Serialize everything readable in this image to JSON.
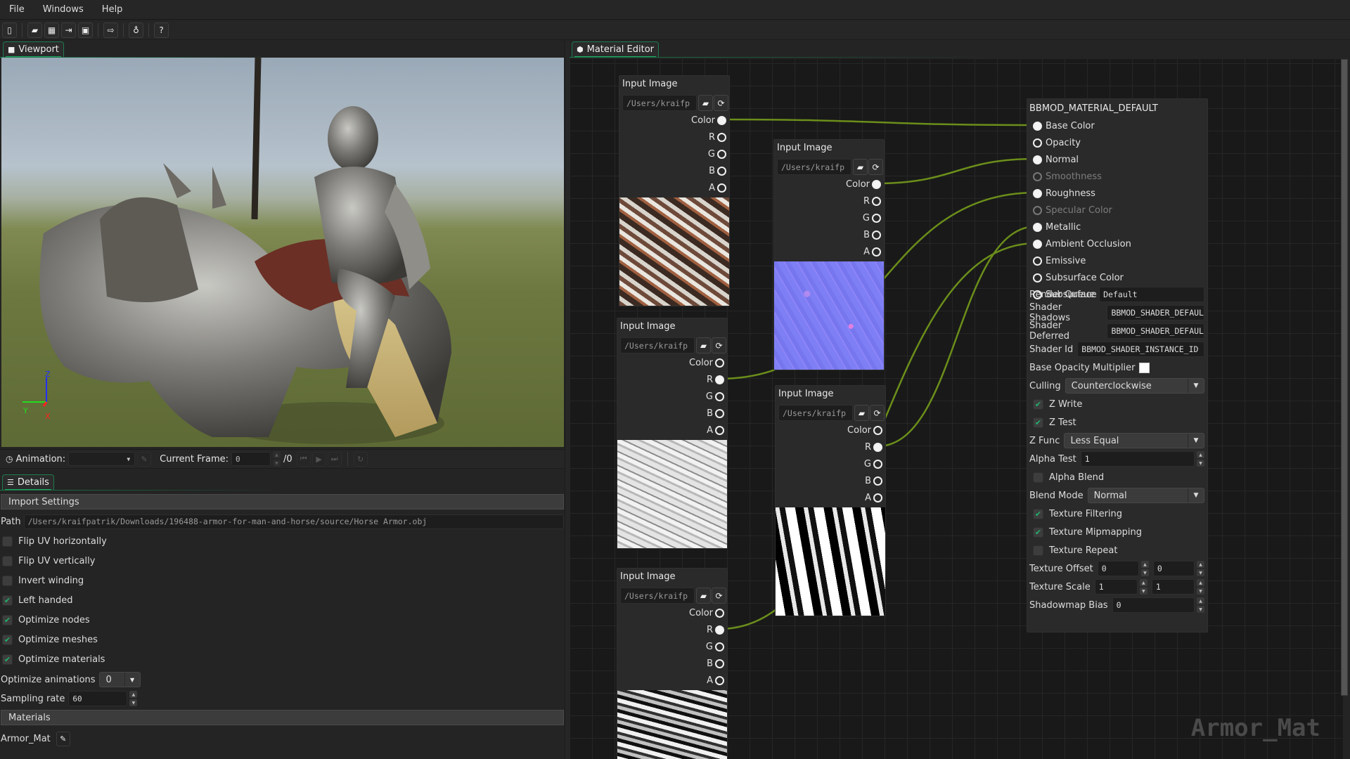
{
  "menu": {
    "items": [
      "File",
      "Windows",
      "Help"
    ]
  },
  "toolbar": {
    "buttons": [
      {
        "name": "new-file-icon",
        "glyph": "🗋"
      },
      {
        "name": "open-folder-icon",
        "glyph": "📂"
      },
      {
        "name": "film-icon",
        "glyph": "🎞"
      },
      {
        "name": "import-icon",
        "glyph": "⇥"
      },
      {
        "name": "image-icon",
        "glyph": "🖼"
      },
      {
        "name": "export-icon",
        "glyph": "⇨"
      },
      {
        "name": "lightbulb-icon",
        "glyph": "💡"
      },
      {
        "name": "help-icon",
        "glyph": "?"
      }
    ]
  },
  "viewport": {
    "tab_label": "Viewport",
    "gizmo": {
      "x_label": "X",
      "y_label": "Y",
      "z_label": "Z",
      "x_color": "#ff2020",
      "y_color": "#20dd20",
      "z_color": "#2030ff"
    }
  },
  "animation_bar": {
    "animation_label": "Animation:",
    "animation_value": "",
    "current_frame_label": "Current Frame:",
    "current_frame_value": "0",
    "frame_total": "/0"
  },
  "details": {
    "tab_label": "Details",
    "import_settings_header": "Import Settings",
    "path_label": "Path",
    "path_value": "/Users/kraifpatrik/Downloads/196488-armor-for-man-and-horse/source/Horse Armor.obj",
    "checkboxes": [
      {
        "label": "Flip UV horizontally",
        "checked": false
      },
      {
        "label": "Flip UV vertically",
        "checked": false
      },
      {
        "label": "Invert winding",
        "checked": false
      },
      {
        "label": "Left handed",
        "checked": true
      },
      {
        "label": "Optimize nodes",
        "checked": true
      },
      {
        "label": "Optimize meshes",
        "checked": true
      },
      {
        "label": "Optimize materials",
        "checked": true
      }
    ],
    "optimize_animations_label": "Optimize animations",
    "optimize_animations_value": "0",
    "sampling_rate_label": "Sampling rate",
    "sampling_rate_value": "60",
    "materials_header": "Materials",
    "material_name": "Armor_Mat"
  },
  "material_editor": {
    "tab_label": "Material Editor",
    "watermark": "Armor_Mat",
    "wire_color": "#6b8e1a",
    "input_nodes": [
      {
        "title": "Input Image",
        "path": "/Users/kraifp",
        "pins": [
          {
            "label": "Color",
            "connected": true
          },
          {
            "label": "R",
            "connected": false
          },
          {
            "label": "G",
            "connected": false
          },
          {
            "label": "B",
            "connected": false
          },
          {
            "label": "A",
            "connected": false
          }
        ],
        "texture": "base-color"
      },
      {
        "title": "Input Image",
        "path": "/Users/kraifp",
        "pins": [
          {
            "label": "Color",
            "connected": true
          },
          {
            "label": "R",
            "connected": false
          },
          {
            "label": "G",
            "connected": false
          },
          {
            "label": "B",
            "connected": false
          },
          {
            "label": "A",
            "connected": false
          }
        ],
        "texture": "normal-map"
      },
      {
        "title": "Input Image",
        "path": "/Users/kraifp",
        "pins": [
          {
            "label": "Color",
            "connected": false
          },
          {
            "label": "R",
            "connected": true
          },
          {
            "label": "G",
            "connected": false
          },
          {
            "label": "B",
            "connected": false
          },
          {
            "label": "A",
            "connected": false
          }
        ],
        "texture": "roughness-map"
      },
      {
        "title": "Input Image",
        "path": "/Users/kraifp",
        "pins": [
          {
            "label": "Color",
            "connected": false
          },
          {
            "label": "R",
            "connected": true
          },
          {
            "label": "G",
            "connected": false
          },
          {
            "label": "B",
            "connected": false
          },
          {
            "label": "A",
            "connected": false
          }
        ],
        "texture": "metallic-map"
      },
      {
        "title": "Input Image",
        "path": "/Users/kraifp",
        "pins": [
          {
            "label": "Color",
            "connected": false
          },
          {
            "label": "R",
            "connected": true
          },
          {
            "label": "G",
            "connected": false
          },
          {
            "label": "B",
            "connected": false
          },
          {
            "label": "A",
            "connected": false
          }
        ],
        "texture": "ao-map"
      }
    ],
    "material_node": {
      "title": "BBMOD_MATERIAL_DEFAULT",
      "inputs": [
        {
          "label": "Base Color",
          "connected": true,
          "enabled": true
        },
        {
          "label": "Opacity",
          "connected": false,
          "enabled": true
        },
        {
          "label": "Normal",
          "connected": true,
          "enabled": true
        },
        {
          "label": "Smoothness",
          "connected": false,
          "enabled": false
        },
        {
          "label": "Roughness",
          "connected": true,
          "enabled": true
        },
        {
          "label": "Specular Color",
          "connected": false,
          "enabled": false
        },
        {
          "label": "Metallic",
          "connected": true,
          "enabled": true
        },
        {
          "label": "Ambient Occlusion",
          "connected": true,
          "enabled": true
        },
        {
          "label": "Emissive",
          "connected": false,
          "enabled": true
        },
        {
          "label": "Subsurface Color",
          "connected": false,
          "enabled": true
        },
        {
          "label": "Subsurface Intensity",
          "connected": false,
          "enabled": true
        }
      ],
      "render_queue_label": "Render Queue",
      "render_queue_value": "Default",
      "shader_shadows_label": "Shader Shadows",
      "shader_shadows_value": "BBMOD_SHADER_DEFAUL",
      "shader_deferred_label": "Shader Deferred",
      "shader_deferred_value": "BBMOD_SHADER_DEFAUL",
      "shader_id_label": "Shader Id",
      "shader_id_value": "BBMOD_SHADER_INSTANCE_ID",
      "base_opacity_label": "Base Opacity Multiplier",
      "base_opacity_color": "#ffffff",
      "culling_label": "Culling",
      "culling_value": "Counterclockwise",
      "z_write_label": "Z Write",
      "z_write": true,
      "z_test_label": "Z Test",
      "z_test": true,
      "z_func_label": "Z Func",
      "z_func_value": "Less Equal",
      "alpha_test_label": "Alpha Test",
      "alpha_test_value": "1",
      "alpha_blend_label": "Alpha Blend",
      "alpha_blend": false,
      "blend_mode_label": "Blend Mode",
      "blend_mode_value": "Normal",
      "texture_filtering_label": "Texture Filtering",
      "texture_filtering": true,
      "texture_mipmapping_label": "Texture Mipmapping",
      "texture_mipmapping": true,
      "texture_repeat_label": "Texture Repeat",
      "texture_repeat": false,
      "texture_offset_label": "Texture Offset",
      "texture_offset_x": "0",
      "texture_offset_y": "0",
      "texture_scale_label": "Texture Scale",
      "texture_scale_x": "1",
      "texture_scale_y": "1",
      "shadowmap_bias_label": "Shadowmap Bias",
      "shadowmap_bias_value": "0"
    }
  }
}
